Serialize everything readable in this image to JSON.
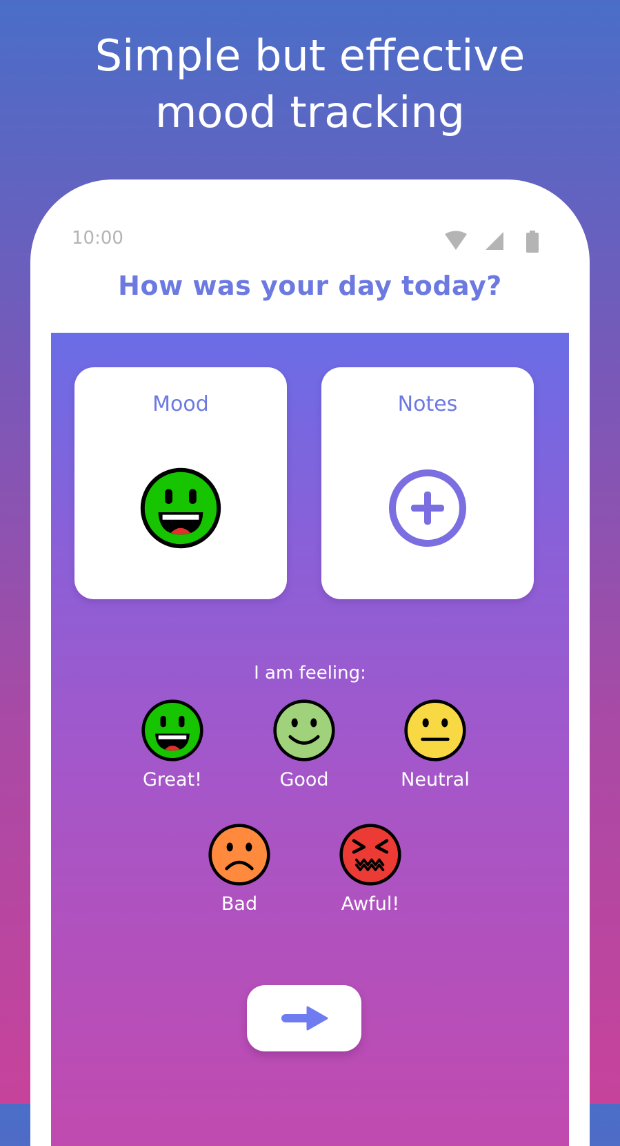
{
  "headline": {
    "line1": "Simple but effective",
    "line2": "mood tracking"
  },
  "status_bar": {
    "time": "10:00",
    "icons": [
      "wifi-icon",
      "signal-icon",
      "battery-icon"
    ]
  },
  "question": "How was your day today?",
  "cards": {
    "mood": {
      "title": "Mood",
      "icon": "great-face-icon"
    },
    "notes": {
      "title": "Notes",
      "icon": "add-circle-icon"
    }
  },
  "feeling": {
    "label": "I am feeling:",
    "options": [
      {
        "label": "Great!",
        "icon": "great-face-icon",
        "color": "#16c400"
      },
      {
        "label": "Good",
        "icon": "good-face-icon",
        "color": "#9fd27a"
      },
      {
        "label": "Neutral",
        "icon": "neutral-face-icon",
        "color": "#f8d944"
      },
      {
        "label": "Bad",
        "icon": "bad-face-icon",
        "color": "#ff8a3d"
      },
      {
        "label": "Awful!",
        "icon": "awful-face-icon",
        "color": "#ec3b35"
      }
    ]
  },
  "next_button": {
    "icon": "arrow-right-icon"
  },
  "colors": {
    "accent": "#6c79e0",
    "status_gray": "#b4b4b4"
  }
}
